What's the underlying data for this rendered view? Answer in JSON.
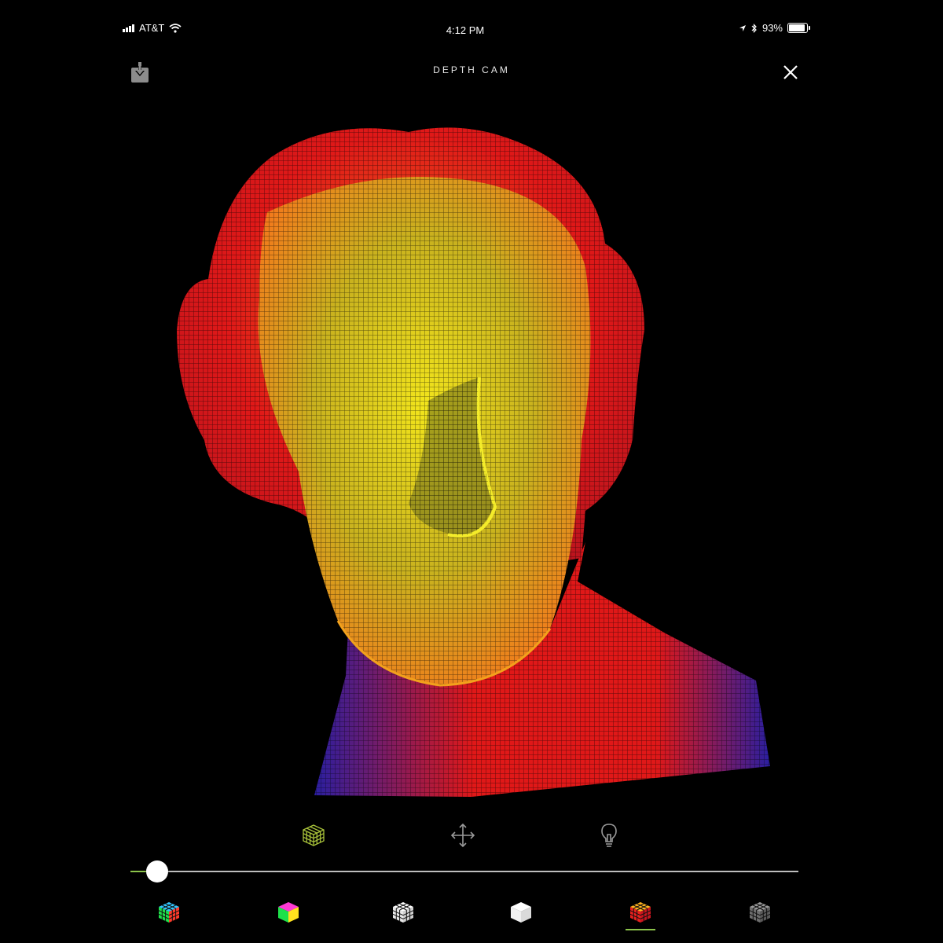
{
  "status_bar": {
    "carrier": "AT&T",
    "time": "4:12 PM",
    "battery_text": "93%",
    "battery_level": 0.93
  },
  "header": {
    "title": "DEPTH CAM",
    "download_icon": "download-icon",
    "close_icon": "close-icon"
  },
  "viewer": {
    "subject": "wireframe depth mesh of a sculpted head",
    "colors": {
      "near": "#f2e51c",
      "mid": "#f27a1c",
      "far": "#e01818",
      "deep": "#2a1ea0"
    }
  },
  "tools": [
    {
      "icon": "mesh-cube-icon",
      "active": true
    },
    {
      "icon": "move-arrows-icon",
      "active": false
    },
    {
      "icon": "lightbulb-icon",
      "active": false
    }
  ],
  "slider": {
    "value": 0.04,
    "accent": "#8bc34a"
  },
  "palettes": [
    {
      "icon": "rainbow-grid-cube-icon",
      "selected": false
    },
    {
      "icon": "rainbow-solid-cube-icon",
      "selected": false
    },
    {
      "icon": "white-grid-cube-icon",
      "selected": false
    },
    {
      "icon": "white-solid-cube-icon",
      "selected": false
    },
    {
      "icon": "heat-grid-cube-icon",
      "selected": true
    },
    {
      "icon": "gray-grid-cube-icon",
      "selected": false
    }
  ]
}
